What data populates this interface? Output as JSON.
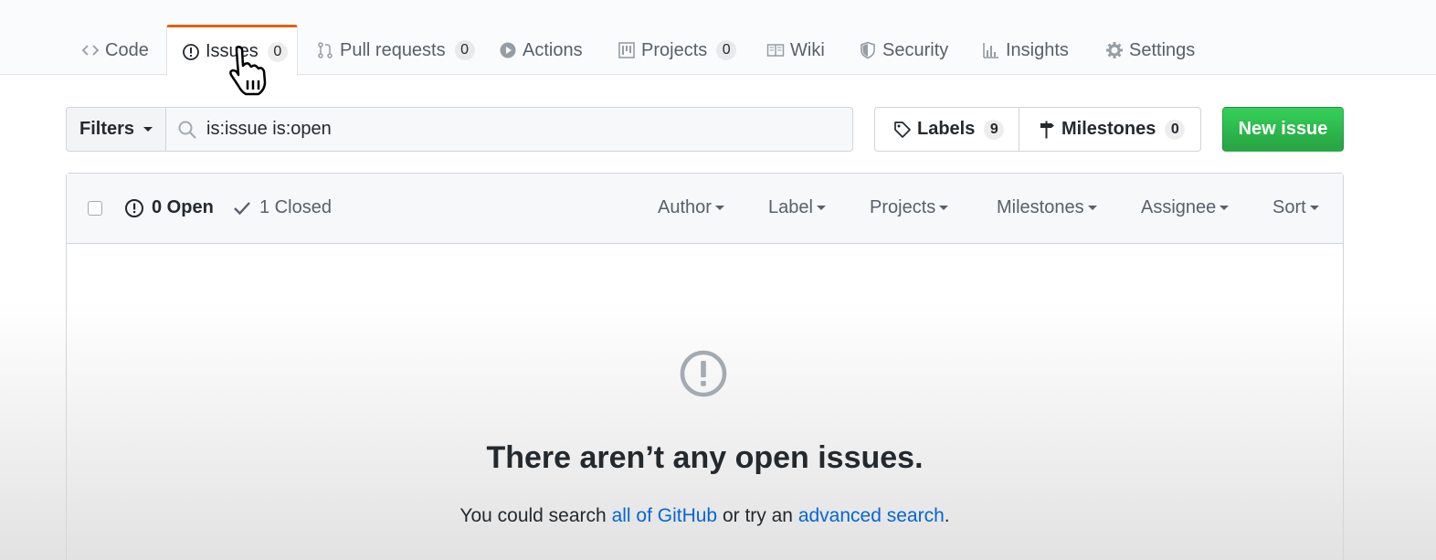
{
  "nav": {
    "tabs": [
      {
        "label": "Code",
        "icon": "code-icon"
      },
      {
        "label": "Issues",
        "icon": "issue-opened-icon",
        "count": "0",
        "selected": true
      },
      {
        "label": "Pull requests",
        "icon": "git-pull-request-icon",
        "count": "0"
      },
      {
        "label": "Actions",
        "icon": "play-icon"
      },
      {
        "label": "Projects",
        "icon": "project-icon",
        "count": "0"
      },
      {
        "label": "Wiki",
        "icon": "book-icon"
      },
      {
        "label": "Security",
        "icon": "shield-icon"
      },
      {
        "label": "Insights",
        "icon": "graph-icon"
      },
      {
        "label": "Settings",
        "icon": "gear-icon"
      }
    ]
  },
  "subnav": {
    "filters_label": "Filters",
    "search_value": "is:issue is:open",
    "labels_label": "Labels",
    "labels_count": "9",
    "milestones_label": "Milestones",
    "milestones_count": "0",
    "new_issue_label": "New issue"
  },
  "issues": {
    "open_label": "0 Open",
    "closed_label": "1 Closed",
    "filters": [
      "Author",
      "Label",
      "Projects",
      "Milestones",
      "Assignee",
      "Sort"
    ]
  },
  "blankslate": {
    "title": "There aren’t any open issues.",
    "text_before": "You could search ",
    "link1": "all of GitHub",
    "text_middle": " or try an ",
    "link2": "advanced search",
    "text_after": "."
  },
  "colors": {
    "accent_tab": "#e36209",
    "primary_button": "#28a745",
    "link": "#0366d6"
  }
}
